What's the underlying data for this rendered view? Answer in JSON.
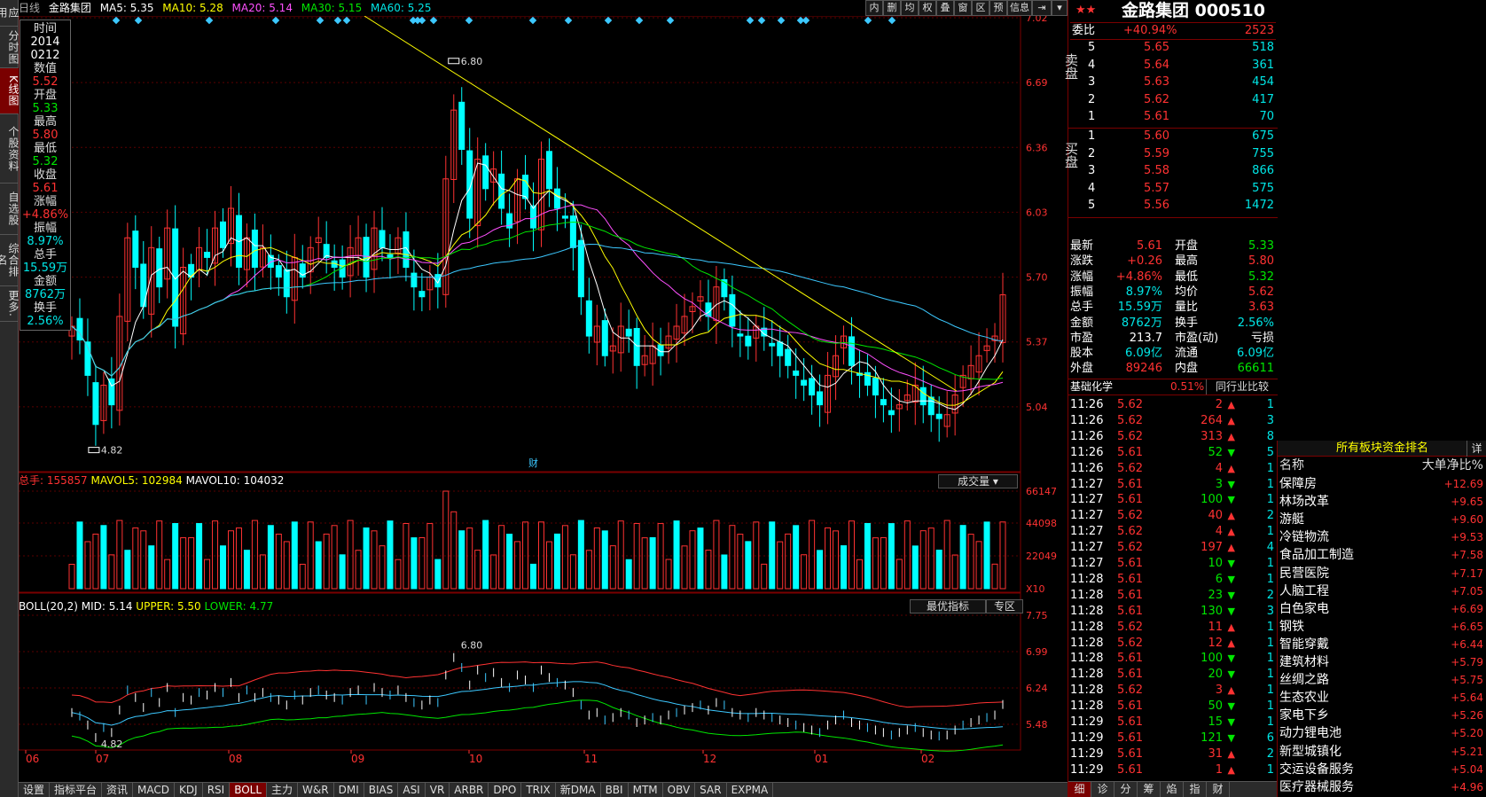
{
  "left_sidebar": [
    "应用",
    "分时图",
    "K线图",
    "个股资料",
    "自选股",
    "综合排名",
    "更多."
  ],
  "topbar": {
    "period": "日线",
    "name": "金路集团",
    "ma5": "MA5: 5.35",
    "ma10": "MA10: 5.28",
    "ma20": "MA20: 5.14",
    "ma30": "MA30: 5.15",
    "ma60": "MA60: 5.25"
  },
  "toolbar": [
    "内",
    "删",
    "均",
    "权",
    "叠",
    "窗",
    "区",
    "预",
    "信息",
    "⇥",
    "▾"
  ],
  "tooltip": {
    "time_label": "时间",
    "time_value_1": "2014",
    "time_value_2": "0212",
    "value_label": "数值",
    "value": "5.52",
    "open_label": "开盘",
    "open": "5.33",
    "high_label": "最高",
    "high": "5.80",
    "low_label": "最低",
    "low": "5.32",
    "close_label": "收盘",
    "close": "5.61",
    "change_label": "涨幅",
    "change": "+4.86%",
    "amp_label": "振幅",
    "amp": "8.97%",
    "vol_label": "总手",
    "vol": "15.59万",
    "amt_label": "金额",
    "amt": "8762万",
    "turn_label": "换手",
    "turn": "2.56%"
  },
  "price_axis": [
    "7.02",
    "6.69",
    "6.36",
    "6.03",
    "5.70",
    "5.37",
    "5.04"
  ],
  "price_marks": {
    "hi": "6.80",
    "lo": "4.82",
    "cai": "财"
  },
  "volume_header": {
    "total": "总手: 155857",
    "mavol5": "MAVOL5: 102984",
    "mavol10": "MAVOL10: 104032",
    "btn": "成交量"
  },
  "volume_axis": [
    "66147",
    "44098",
    "22049",
    "X10"
  ],
  "boll_header": {
    "name": "BOLL(20,2)",
    "mid": "MID: 5.14",
    "upper": "UPPER: 5.50",
    "lower": "LOWER: 4.77",
    "btn1": "最优指标",
    "btn2": "专区"
  },
  "boll_axis": [
    "7.75",
    "6.99",
    "6.24",
    "5.48"
  ],
  "date_axis": [
    "06",
    "07",
    "08",
    "09",
    "10",
    "11",
    "12",
    "01",
    "02"
  ],
  "bottom_tabs": [
    "设置",
    "指标平台",
    "资讯",
    "MACD",
    "KDJ",
    "RSI",
    "BOLL",
    "主力",
    "W&R",
    "DMI",
    "BIAS",
    "ASI",
    "VR",
    "ARBR",
    "DPO",
    "TRIX",
    "新DMA",
    "BBI",
    "MTM",
    "OBV",
    "SAR",
    "EXPMA"
  ],
  "stock": {
    "stars": "★★",
    "title": "金路集团 000510"
  },
  "weibi": {
    "label": "委比",
    "pct": "+40.94%",
    "val": "2523"
  },
  "sell_label": "卖盘",
  "buy_label": "买盘",
  "sell": [
    {
      "n": "5",
      "p": "5.65",
      "v": "518"
    },
    {
      "n": "4",
      "p": "5.64",
      "v": "361"
    },
    {
      "n": "3",
      "p": "5.63",
      "v": "454"
    },
    {
      "n": "2",
      "p": "5.62",
      "v": "417"
    },
    {
      "n": "1",
      "p": "5.61",
      "v": "70"
    }
  ],
  "buy": [
    {
      "n": "1",
      "p": "5.60",
      "v": "675"
    },
    {
      "n": "2",
      "p": "5.59",
      "v": "755"
    },
    {
      "n": "3",
      "p": "5.58",
      "v": "866"
    },
    {
      "n": "4",
      "p": "5.57",
      "v": "575"
    },
    {
      "n": "5",
      "p": "5.56",
      "v": "1472"
    }
  ],
  "quote": [
    {
      "l1": "最新",
      "v1": "5.61",
      "c1": "red",
      "l2": "开盘",
      "v2": "5.33",
      "c2": "green"
    },
    {
      "l1": "涨跌",
      "v1": "+0.26",
      "c1": "red",
      "l2": "最高",
      "v2": "5.80",
      "c2": "red"
    },
    {
      "l1": "涨幅",
      "v1": "+4.86%",
      "c1": "red",
      "l2": "最低",
      "v2": "5.32",
      "c2": "green"
    },
    {
      "l1": "振幅",
      "v1": "8.97%",
      "c1": "cyan",
      "l2": "均价",
      "v2": "5.62",
      "c2": "red"
    },
    {
      "l1": "总手",
      "v1": "15.59万",
      "c1": "cyan",
      "l2": "量比",
      "v2": "3.63",
      "c2": "red"
    },
    {
      "l1": "金额",
      "v1": "8762万",
      "c1": "cyan",
      "l2": "换手",
      "v2": "2.56%",
      "c2": "cyan"
    },
    {
      "l1": "市盈",
      "v1": "213.7",
      "c1": "white",
      "l2": "市盈(动)",
      "v2": "亏损",
      "c2": "white"
    },
    {
      "l1": "股本",
      "v1": "6.09亿",
      "c1": "cyan",
      "l2": "流通",
      "v2": "6.09亿",
      "c2": "cyan"
    },
    {
      "l1": "外盘",
      "v1": "89246",
      "c1": "red",
      "l2": "内盘",
      "v2": "66611",
      "c2": "green"
    }
  ],
  "fund": {
    "label": "基础化学",
    "pct": "0.51%",
    "cmp": "同行业比较"
  },
  "ticks": [
    {
      "t": "11:26",
      "p": "5.62",
      "pc": "red",
      "v": "2",
      "d": "up",
      "n": "1"
    },
    {
      "t": "11:26",
      "p": "5.62",
      "pc": "red",
      "v": "264",
      "d": "up",
      "n": "3"
    },
    {
      "t": "11:26",
      "p": "5.62",
      "pc": "red",
      "v": "313",
      "d": "up",
      "n": "8"
    },
    {
      "t": "11:26",
      "p": "5.61",
      "pc": "red",
      "v": "52",
      "d": "down",
      "n": "5"
    },
    {
      "t": "11:26",
      "p": "5.62",
      "pc": "red",
      "v": "4",
      "d": "up",
      "n": "1"
    },
    {
      "t": "11:27",
      "p": "5.61",
      "pc": "red",
      "v": "3",
      "d": "down",
      "n": "1"
    },
    {
      "t": "11:27",
      "p": "5.61",
      "pc": "red",
      "v": "100",
      "d": "down",
      "n": "1"
    },
    {
      "t": "11:27",
      "p": "5.62",
      "pc": "red",
      "v": "40",
      "d": "up",
      "n": "2"
    },
    {
      "t": "11:27",
      "p": "5.62",
      "pc": "red",
      "v": "4",
      "d": "up",
      "n": "1"
    },
    {
      "t": "11:27",
      "p": "5.62",
      "pc": "red",
      "v": "197",
      "d": "up",
      "n": "4"
    },
    {
      "t": "11:27",
      "p": "5.61",
      "pc": "red",
      "v": "10",
      "d": "down",
      "n": "1"
    },
    {
      "t": "11:28",
      "p": "5.61",
      "pc": "red",
      "v": "6",
      "d": "down",
      "n": "1"
    },
    {
      "t": "11:28",
      "p": "5.61",
      "pc": "red",
      "v": "23",
      "d": "down",
      "n": "2"
    },
    {
      "t": "11:28",
      "p": "5.61",
      "pc": "red",
      "v": "130",
      "d": "down",
      "n": "3"
    },
    {
      "t": "11:28",
      "p": "5.62",
      "pc": "red",
      "v": "11",
      "d": "up",
      "n": "1"
    },
    {
      "t": "11:28",
      "p": "5.62",
      "pc": "red",
      "v": "12",
      "d": "up",
      "n": "1"
    },
    {
      "t": "11:28",
      "p": "5.61",
      "pc": "red",
      "v": "100",
      "d": "down",
      "n": "1"
    },
    {
      "t": "11:28",
      "p": "5.61",
      "pc": "red",
      "v": "20",
      "d": "down",
      "n": "1"
    },
    {
      "t": "11:28",
      "p": "5.62",
      "pc": "red",
      "v": "3",
      "d": "up",
      "n": "1"
    },
    {
      "t": "11:28",
      "p": "5.61",
      "pc": "red",
      "v": "50",
      "d": "down",
      "n": "1"
    },
    {
      "t": "11:29",
      "p": "5.61",
      "pc": "red",
      "v": "15",
      "d": "down",
      "n": "1"
    },
    {
      "t": "11:29",
      "p": "5.61",
      "pc": "red",
      "v": "121",
      "d": "down",
      "n": "6"
    },
    {
      "t": "11:29",
      "p": "5.61",
      "pc": "red",
      "v": "31",
      "d": "up",
      "n": "2"
    },
    {
      "t": "11:29",
      "p": "5.61",
      "pc": "red",
      "v": "1",
      "d": "up",
      "n": "1"
    }
  ],
  "right_bottom_tabs": [
    "细",
    "诊",
    "分",
    "筹",
    "焰",
    "指",
    "财"
  ],
  "board": {
    "title": "所有板块资金排名",
    "more": "详",
    "col1": "名称",
    "col2": "大单净比%",
    "rows": [
      {
        "n": "保障房",
        "v": "+12.69"
      },
      {
        "n": "林场改革",
        "v": "+9.65"
      },
      {
        "n": "游艇",
        "v": "+9.60"
      },
      {
        "n": "冷链物流",
        "v": "+9.53"
      },
      {
        "n": "食品加工制造",
        "v": "+7.58"
      },
      {
        "n": "民营医院",
        "v": "+7.17"
      },
      {
        "n": "人脑工程",
        "v": "+7.05"
      },
      {
        "n": "白色家电",
        "v": "+6.69"
      },
      {
        "n": "钢铁",
        "v": "+6.65"
      },
      {
        "n": "智能穿戴",
        "v": "+6.44"
      },
      {
        "n": "建筑材料",
        "v": "+5.79"
      },
      {
        "n": "丝绸之路",
        "v": "+5.75"
      },
      {
        "n": "生态农业",
        "v": "+5.64"
      },
      {
        "n": "家电下乡",
        "v": "+5.26"
      },
      {
        "n": "动力锂电池",
        "v": "+5.20"
      },
      {
        "n": "新型城镇化",
        "v": "+5.21"
      },
      {
        "n": "交运设备服务",
        "v": "+5.04"
      },
      {
        "n": "医疗器械服务",
        "v": "+4.96"
      }
    ]
  },
  "colors": {
    "up": "#ff3232",
    "down": "#00ffff",
    "ma5": "#ffffff",
    "ma10": "#ffff00",
    "ma20": "#ff50ff",
    "ma30": "#00e600",
    "ma60": "#3cc8ff",
    "frame": "#7a0000"
  },
  "chart_data": {
    "type": "candlestick",
    "ylim": [
      4.71,
      7.02
    ],
    "closes": [
      5.45,
      5.38,
      5.2,
      4.95,
      5.15,
      5.05,
      5.5,
      5.9,
      5.75,
      5.55,
      5.85,
      5.65,
      5.95,
      5.45,
      5.75,
      5.7,
      5.85,
      5.8,
      5.95,
      5.85,
      6.05,
      5.75,
      5.9,
      5.75,
      5.85,
      5.75,
      5.7,
      5.6,
      5.8,
      5.7,
      5.85,
      5.9,
      5.8,
      5.75,
      5.7,
      5.85,
      5.9,
      5.7,
      5.95,
      5.85,
      5.8,
      5.9,
      5.75,
      5.65,
      5.6,
      5.7,
      5.65,
      6.2,
      6.55,
      6.35,
      6.0,
      6.3,
      6.15,
      6.25,
      6.05,
      5.95,
      6.2,
      6.1,
      5.95,
      6.3,
      6.15,
      6.05,
      6.0,
      5.85,
      5.6,
      5.4,
      5.45,
      5.3,
      5.35,
      5.45,
      5.4,
      5.25,
      5.3,
      5.35,
      5.3,
      5.4,
      5.45,
      5.5,
      5.55,
      5.6,
      5.5,
      5.65,
      5.6,
      5.45,
      5.4,
      5.35,
      5.45,
      5.4,
      5.35,
      5.3,
      5.25,
      5.2,
      5.15,
      5.1,
      5.05,
      5.2,
      5.3,
      5.4,
      5.25,
      5.2,
      5.15,
      5.1,
      5.05,
      5.0,
      5.05,
      5.1,
      5.15,
      5.05,
      5.0,
      4.98,
      5.0,
      5.1,
      5.2,
      5.25,
      5.3,
      5.35,
      5.4,
      5.61
    ]
  }
}
